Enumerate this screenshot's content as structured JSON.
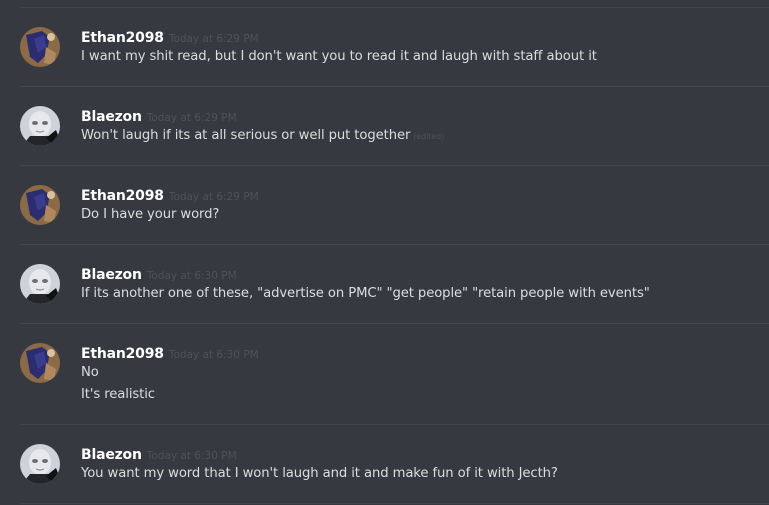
{
  "messages": [
    {
      "author": "Ethan2098",
      "avatar": "ethan-avatar",
      "timestamp": "Today at 6:29 PM",
      "lines": [
        "I want my shit read, but I don't want you to read it and laugh with staff about it"
      ]
    },
    {
      "author": "Blaezon",
      "avatar": "blaezon-avatar",
      "timestamp": "Today at 6:29 PM",
      "lines": [
        "Won't laugh if its at all serious or well put together"
      ],
      "edited_label": "(edited)"
    },
    {
      "author": "Ethan2098",
      "avatar": "ethan-avatar",
      "timestamp": "Today at 6:29 PM",
      "lines": [
        "Do I have your word?"
      ]
    },
    {
      "author": "Blaezon",
      "avatar": "blaezon-avatar",
      "timestamp": "Today at 6:30 PM",
      "lines": [
        "If its another one of these, \"advertise on PMC\" \"get people\" \"retain people with events\""
      ]
    },
    {
      "author": "Ethan2098",
      "avatar": "ethan-avatar",
      "timestamp": "Today at 6:30 PM",
      "lines": [
        "No",
        "It's realistic"
      ]
    },
    {
      "author": "Blaezon",
      "avatar": "blaezon-avatar",
      "timestamp": "Today at 6:30 PM",
      "lines": [
        "You want my word that I won't laugh and it and make fun of it with Jecth?"
      ]
    }
  ],
  "colors": {
    "background": "#36393f",
    "divider": "#42454a",
    "username": "#ffffff",
    "text": "#dcddde",
    "timestamp": "#4f5257"
  }
}
